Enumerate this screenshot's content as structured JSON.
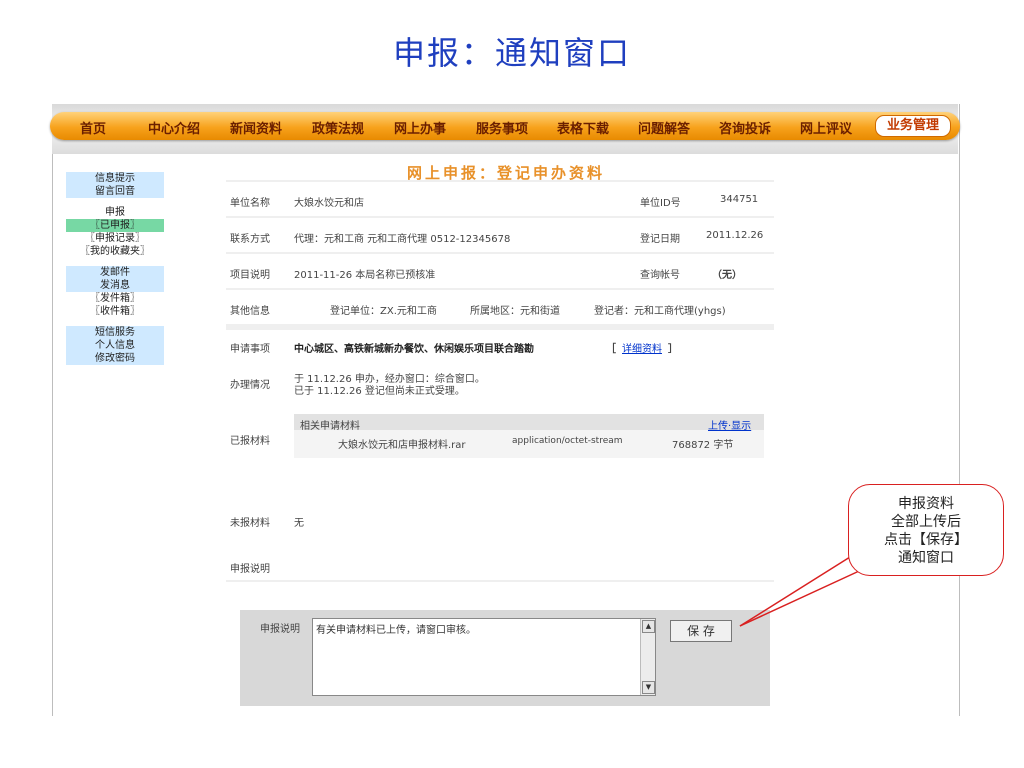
{
  "slide_title": "申报：通知窗口",
  "nav": [
    "首页",
    "中心介绍",
    "新闻资料",
    "政策法规",
    "网上办事",
    "服务事项",
    "表格下载",
    "问题解答",
    "咨询投诉",
    "网上评议"
  ],
  "nav_active": "业务管理",
  "sidebar": [
    "信息提示",
    "留言回音",
    "申报",
    "〖已申报〗",
    "〖申报记录〗",
    "〖我的收藏夹〗",
    "发邮件",
    "发消息",
    "〖发件箱〗",
    "〖收件箱〗",
    "短信服务",
    "个人信息",
    "修改密码"
  ],
  "main_title": "网上申报：登记申办资料",
  "fields": {
    "unit_name_label": "单位名称",
    "unit_name": "大娘水饺元和店",
    "unit_id_label": "单位ID号",
    "unit_id": "344751",
    "contact_label": "联系方式",
    "contact": "代理：元和工商 元和工商代理 0512-12345678",
    "reg_date_label": "登记日期",
    "reg_date": "2011.12.26",
    "project_label": "项目说明",
    "project": "2011-11-26 本局名称已预核准",
    "query_label": "查询帐号",
    "query": "（无）",
    "other_label": "其他信息",
    "other_unit": "登记单位：ZX.元和工商",
    "other_area": "所属地区：元和街道",
    "other_reg": "登记者：元和工商代理(yhgs)",
    "apply_label": "申请事项",
    "apply": "中心城区、高铁新城新办餐饮、休闲娱乐项目联合踏勘",
    "apply_open": "［",
    "apply_link": "详细资料",
    "apply_close": "］",
    "status_label": "办理情况",
    "status_line1": "于 11.12.26 申办，经办窗口：综合窗口。",
    "status_line2": "已于 11.12.26 登记但尚未正式受理。",
    "submitted_label": "已报材料",
    "materials_header": "相关申请材料",
    "upload_link": "上传·显示",
    "file_name": "大娘水饺元和店申报材料.rar",
    "file_type": "application/octet-stream",
    "file_size": "768872 字节",
    "unsubmitted_label": "未报材料",
    "unsubmitted": "无",
    "note_label": "申报说明"
  },
  "bottom": {
    "label": "申报说明",
    "textarea_value": "有关申请材料已上传，请窗口审核。",
    "save_label": "保 存"
  },
  "callout": [
    "申报资料",
    "全部上传后",
    "点击【保存】",
    "通知窗口"
  ],
  "colors": {
    "title": "#1f3fbf",
    "nav": "#f7a21c",
    "callout_border": "#d92020"
  }
}
